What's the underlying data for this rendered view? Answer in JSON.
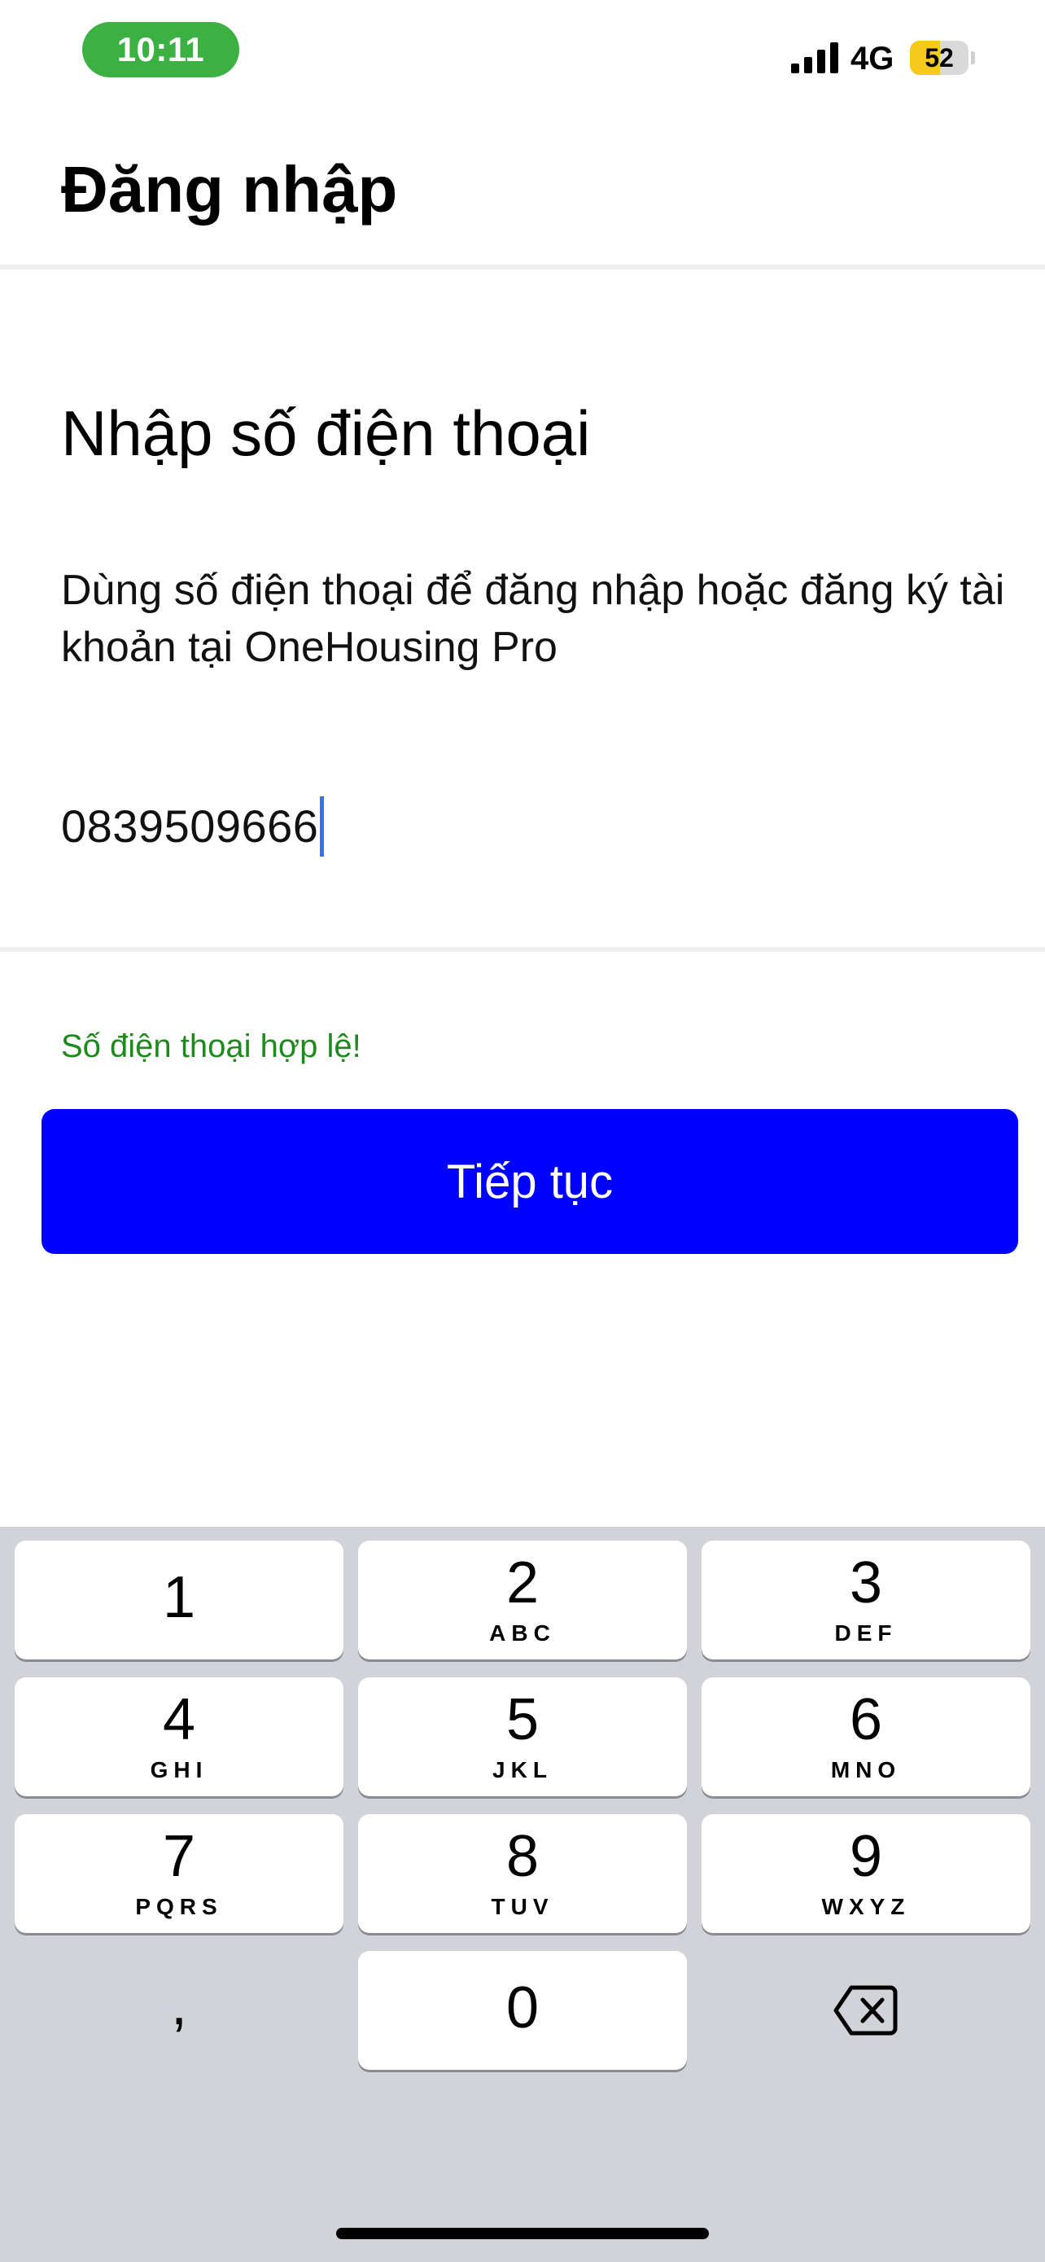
{
  "status_bar": {
    "time": "10:11",
    "time_pill_color": "#3cb043",
    "signal_icon": "cellular-signal-icon",
    "network": "4G",
    "battery_level": 52,
    "battery_text": "52",
    "battery_color": "#f7c91a"
  },
  "header": {
    "title": "Đăng nhập"
  },
  "main": {
    "section_title": "Nhập số điện thoại",
    "description": "Dùng số điện thoại để đăng nhập hoặc đăng ký tài khoản tại OneHousing Pro",
    "phone_value": "0839509666",
    "validation_message": "Số điện thoại hợp lệ!",
    "validation_color": "#1e8a1e",
    "continue_label": "Tiếp tục",
    "continue_color": "#0000ff"
  },
  "keypad": {
    "keys": [
      {
        "digit": "1",
        "letters": ""
      },
      {
        "digit": "2",
        "letters": "ABC"
      },
      {
        "digit": "3",
        "letters": "DEF"
      },
      {
        "digit": "4",
        "letters": "GHI"
      },
      {
        "digit": "5",
        "letters": "JKL"
      },
      {
        "digit": "6",
        "letters": "MNO"
      },
      {
        "digit": "7",
        "letters": "PQRS"
      },
      {
        "digit": "8",
        "letters": "TUV"
      },
      {
        "digit": "9",
        "letters": "WXYZ"
      },
      {
        "digit": "0",
        "letters": ""
      }
    ],
    "comma": ",",
    "delete_icon": "backspace-icon",
    "background": "#d1d3d9"
  }
}
